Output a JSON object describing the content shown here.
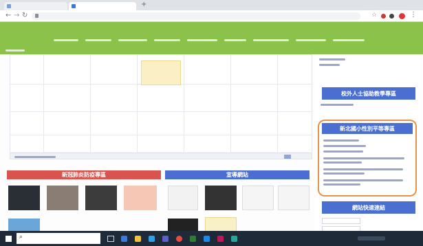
{
  "browser": {
    "tabs": [
      {
        "label": ""
      },
      {
        "label": ""
      }
    ],
    "new_tab_label": "+",
    "url": ""
  },
  "site_nav": {
    "items": [
      {
        "label": ""
      },
      {
        "label": ""
      },
      {
        "label": ""
      },
      {
        "label": ""
      },
      {
        "label": ""
      },
      {
        "label": ""
      },
      {
        "label": ""
      },
      {
        "label": ""
      },
      {
        "label": ""
      }
    ],
    "account": ""
  },
  "sidebar": {
    "top_links": [
      {
        "label": ""
      },
      {
        "label": ""
      }
    ],
    "section1": {
      "title": "校外人士協助教學專區",
      "links": [
        {
          "label": ""
        }
      ]
    },
    "section2": {
      "title": "新北國小性別平等專區",
      "links": [
        {
          "label": ""
        },
        {
          "label": ""
        },
        {
          "label": ""
        },
        {
          "label": ""
        },
        {
          "label": ""
        },
        {
          "label": ""
        }
      ]
    },
    "section3": {
      "title": "網站快速連結"
    }
  },
  "bottom": {
    "left_banner": "新冠肺炎防疫專區",
    "right_banner": "宣導網站"
  },
  "taskbar": {
    "search_placeholder": "",
    "time": "",
    "date": ""
  },
  "colors": {
    "accent_green": "#8bc34a",
    "banner_red": "#d9534f",
    "banner_blue": "#4a6fd1",
    "highlight": "#e8914a"
  }
}
